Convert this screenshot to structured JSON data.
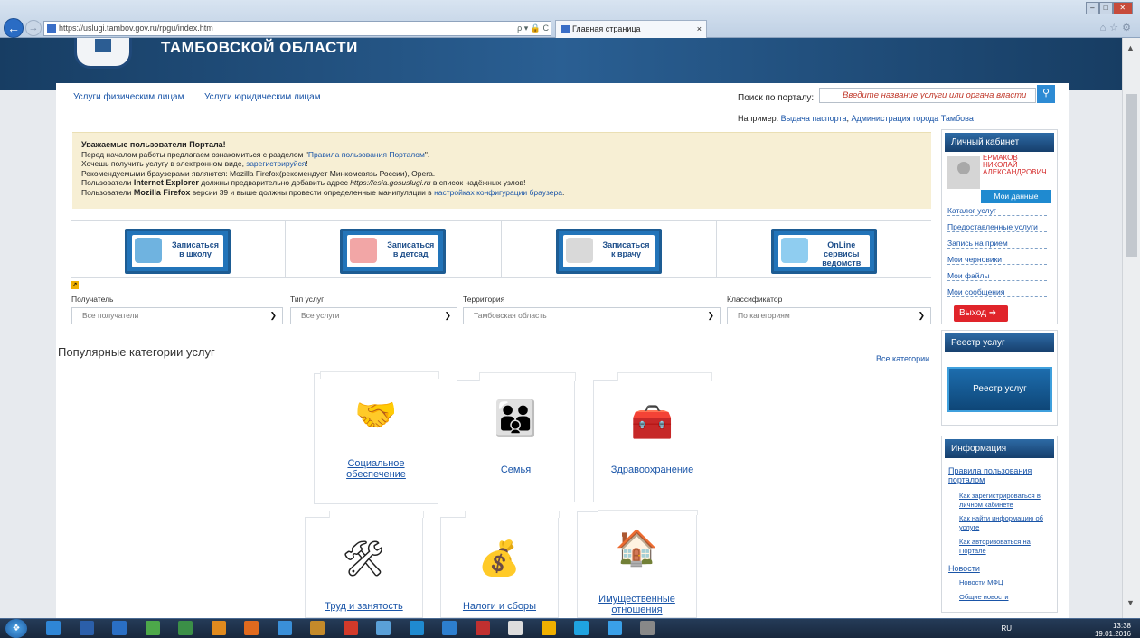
{
  "browser": {
    "url": "https://uslugi.tambov.gov.ru/rpgu/index.htm",
    "url_tools": "ρ ▾ 🔒 C",
    "tab_title": "Главная страница",
    "tab_close": "×"
  },
  "header": {
    "title": "ТАМБОВСКОЙ ОБЛАСТИ"
  },
  "nav": {
    "individuals": "Услуги физическим лицам",
    "legal": "Услуги юридическим лицам"
  },
  "search": {
    "label": "Поиск по порталу:",
    "placeholder": "Введите название услуги или органа власти",
    "example_label": "Например:",
    "example_1": "Выдача паспорта",
    "example_sep": ", ",
    "example_2": "Администрация города Тамбова"
  },
  "notice": {
    "heading": "Уважаемые пользователи Портала!",
    "line1_pre": "Перед началом работы предлагаем ознакомиться с разделом \"",
    "line1_link": "Правила пользования Порталом",
    "line1_post": "\".",
    "line2_pre": "Хочешь получить услугу в электронном виде, ",
    "line2_link": "зарегистрируйся",
    "line2_post": "!",
    "line3": "Рекомендуемыми браузерами являются: Mozilla Firefox(рекомендует Минкомсвязь России), Opera.",
    "line4_pre": "Пользователи ",
    "line4_bold": "Internet Explorer",
    "line4_mid": " должны предварительно добавить адрес ",
    "line4_italic": "https://esia.gosuslugi.ru",
    "line4_post": " в список надёжных узлов!",
    "line5_pre": "Пользователи ",
    "line5_bold": "Mozilla Firefox",
    "line5_mid": " версии 39 и выше должны провести определенные манипуляции в ",
    "line5_link": "настройках конфигурации браузера",
    "line5_post": "."
  },
  "quick": [
    {
      "line1": "Записаться",
      "line2": "в школу",
      "pic_color": "#6fb3e0"
    },
    {
      "line1": "Записаться",
      "line2": "в детсад",
      "pic_color": "#f2a6a6"
    },
    {
      "line1": "Записаться",
      "line2": "к врачу",
      "pic_color": "#d9d9d9"
    },
    {
      "line1": "OnLine сервисы",
      "line2": "ведомств",
      "pic_color": "#8fcdf0"
    }
  ],
  "filters": [
    {
      "label": "Получатель",
      "value": "Все получатели"
    },
    {
      "label": "Тип услуг",
      "value": "Все услуги"
    },
    {
      "label": "Территория",
      "value": "Тамбовская область"
    },
    {
      "label": "Классификатор",
      "value": "По категориям"
    }
  ],
  "popular": {
    "title": "Популярные категории услуг",
    "all_link": "Все категории"
  },
  "categories": [
    {
      "line1": "Социальное",
      "line2": "обеспечение",
      "icon": "🤝"
    },
    {
      "line1": "Семья",
      "line2": "",
      "icon": "👪"
    },
    {
      "line1": "Здравоохранение",
      "line2": "",
      "icon": "🧰"
    },
    {
      "line1": "Труд и занятость",
      "line2": "",
      "icon": "🛠"
    },
    {
      "line1": "Налоги и сборы",
      "line2": "",
      "icon": "💰"
    },
    {
      "line1": "Имущественные",
      "line2": "отношения",
      "icon": "🏠"
    }
  ],
  "cabinet": {
    "title": "Личный кабинет",
    "name_1": "ЕРМАКОВ",
    "name_2": "НИКОЛАЙ",
    "name_3": "АЛЕКСАНДРОВИЧ",
    "my_data": "Мои данные",
    "links": [
      "Каталог услуг",
      "Предоставленные услуги",
      "Запись на прием",
      "Мои черновики",
      "Мои файлы",
      "Мои сообщения"
    ],
    "exit": "Выход"
  },
  "registry": {
    "title": "Реестр услуг",
    "button": "Реестр услуг"
  },
  "info": {
    "title": "Информация",
    "rules_1": "Правила пользования",
    "rules_2": "порталом",
    "sub1_1": "Как зарегистрироваться в",
    "sub1_2": "личном кабинете",
    "sub2_1": "Как найти информацию об",
    "sub2_2": "услуге",
    "sub3_1": "Как авторизоваться на",
    "sub3_2": "Портале",
    "news": "Новости",
    "news_1": "Новости МФЦ",
    "news_2": "Общие новости"
  },
  "taskbar": {
    "lang": "RU",
    "time": "13:38",
    "date": "19.01.2016",
    "icon_colors": [
      "#2f86d6",
      "#2b5faa",
      "#2a6fc4",
      "#4da84a",
      "#3b8f47",
      "#e08a1e",
      "#e06a1e",
      "#3a8fd8",
      "#c48a2a",
      "#d23a2a",
      "#5aa0d8",
      "#1f8ad0",
      "#2d7fcf",
      "#c03030",
      "#ddd",
      "#f0b000",
      "#1fa3e0",
      "#3aa0e8",
      "#888"
    ]
  }
}
